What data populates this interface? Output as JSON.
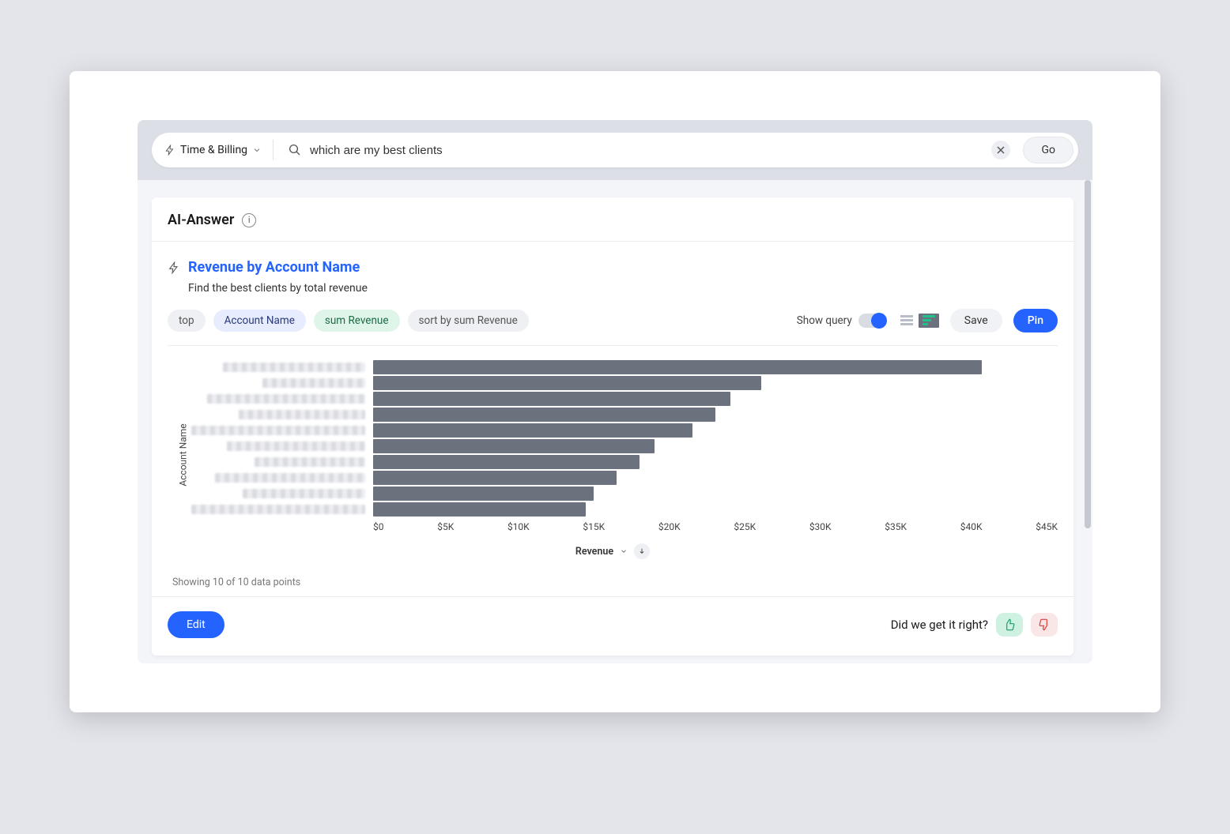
{
  "search": {
    "scope_label": "Time & Billing",
    "query": "which are my best clients",
    "go_label": "Go"
  },
  "answer": {
    "section_title": "AI-Answer",
    "title": "Revenue by Account Name",
    "subtitle": "Find the best clients by total revenue"
  },
  "pills": {
    "p1": "top",
    "p2": "Account Name",
    "p3": "sum Revenue",
    "p4": "sort by sum Revenue"
  },
  "controls": {
    "show_query_label": "Show query",
    "save_label": "Save",
    "pin_label": "Pin"
  },
  "chart_data": {
    "type": "bar",
    "orientation": "horizontal",
    "ylabel": "Account Name",
    "xlabel": "Revenue",
    "xlim": [
      0,
      45000
    ],
    "ticks": [
      "$0",
      "$5K",
      "$10K",
      "$15K",
      "$20K",
      "$25K",
      "$30K",
      "$35K",
      "$40K",
      "$45K"
    ],
    "categories_redacted": true,
    "values": [
      40000,
      25500,
      23500,
      22500,
      21000,
      18500,
      17500,
      16000,
      14500,
      14000
    ],
    "sort_direction": "desc"
  },
  "chart_meta": {
    "datapoints_label": "Showing 10 of 10 data points"
  },
  "footer": {
    "edit_label": "Edit",
    "feedback_prompt": "Did we get it right?"
  }
}
